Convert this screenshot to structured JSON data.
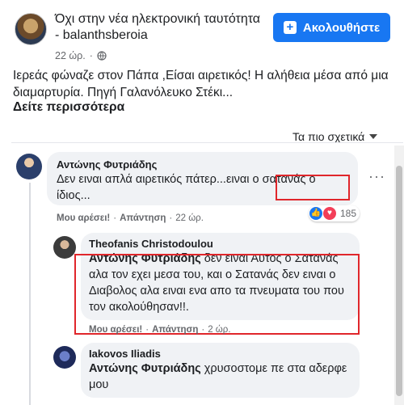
{
  "post": {
    "page_name": "Όχι στην νέα ηλεκτρονική ταυτότητα - balanthsberoia",
    "time": "22 ώρ.",
    "privacy_icon": "globe-icon",
    "follow_label": "Ακολουθήστε",
    "text": "Ιερεάς φώναζε στον Πάπα ,Είσαι αιρετικός! Η αλήθεια μέσα από μια διαμαρτυρία. Πηγή Γαλανόλευκο Στέκι...",
    "see_more": "Δείτε περισσότερα"
  },
  "sort_label": "Τα πιο σχετικά",
  "comments": [
    {
      "author": "Αντώνης Φυτριάδης",
      "text_pre": "Δεν ειναι απλά αιρετικός πάτερ...ειναι ο ",
      "text_box": "σατανάς ο",
      "text_post": " ίδιος...",
      "like": "Μου αρέσει!",
      "reply": "Απάντηση",
      "time": "22 ώρ.",
      "reaction_count": "185"
    },
    {
      "author": "Theofanis Christodoulou",
      "mention": "Αντώνης Φυτριάδης",
      "text": " δεν ειναι Αυτος ο Σατανάς αλα τον εχει μεσα του, και ο Σατανάς δεν ειναι ο Διαβολος αλα ειναι ενα απο τα πνευματα του που τον ακολούθησαν!!.",
      "like": "Μου αρέσει!",
      "reply": "Απάντηση",
      "time": "2 ώρ."
    },
    {
      "author": "Iakovos Iliadis",
      "mention": "Αντώνης Φυτριάδης",
      "text": " χρυσοστομε πε στα αδερφε μου"
    }
  ],
  "colors": {
    "accent": "#1877f2",
    "highlight": "#e0262b"
  }
}
